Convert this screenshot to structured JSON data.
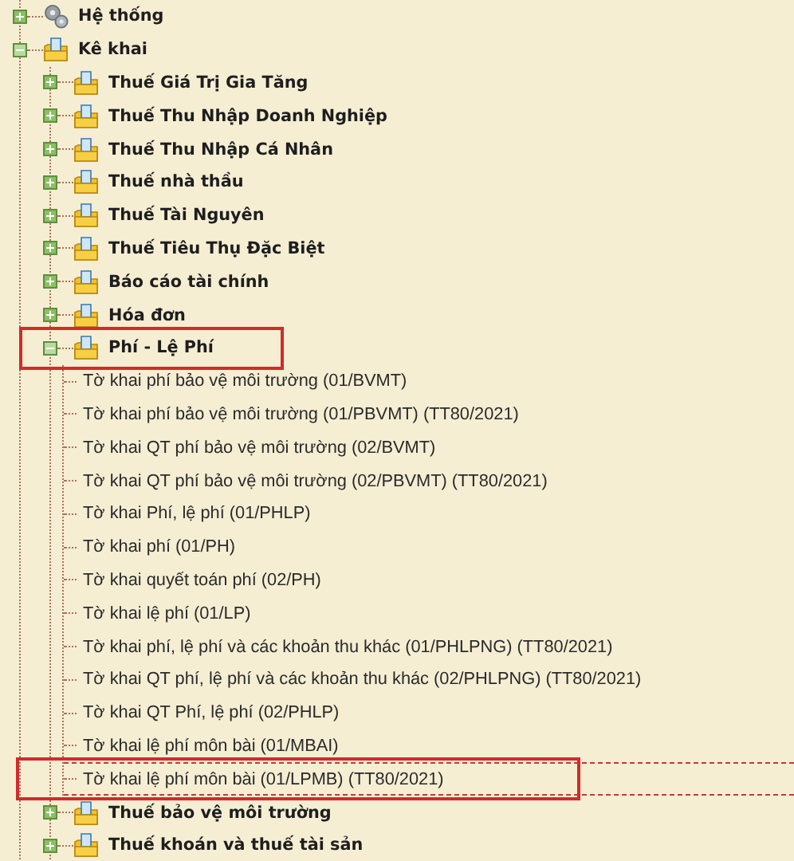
{
  "tree": [
    {
      "label": "Hệ thống",
      "kind": "system",
      "expanded": false,
      "selected": false,
      "highlighted": false
    },
    {
      "label": "Kê khai",
      "kind": "folder",
      "expanded": true,
      "selected": false,
      "highlighted": false,
      "children": [
        {
          "label": "Thuế Giá Trị Gia Tăng",
          "kind": "folder",
          "expanded": false,
          "selected": false,
          "highlighted": false
        },
        {
          "label": "Thuế Thu Nhập Doanh Nghiệp",
          "kind": "folder",
          "expanded": false,
          "selected": false,
          "highlighted": false
        },
        {
          "label": "Thuế Thu Nhập Cá Nhân",
          "kind": "folder",
          "expanded": false,
          "selected": false,
          "highlighted": false
        },
        {
          "label": "Thuế nhà thầu",
          "kind": "folder",
          "expanded": false,
          "selected": false,
          "highlighted": false
        },
        {
          "label": "Thuế Tài Nguyên",
          "kind": "folder",
          "expanded": false,
          "selected": false,
          "highlighted": false
        },
        {
          "label": "Thuế Tiêu Thụ Đặc Biệt",
          "kind": "folder",
          "expanded": false,
          "selected": false,
          "highlighted": false
        },
        {
          "label": "Báo cáo tài chính",
          "kind": "folder",
          "expanded": false,
          "selected": false,
          "highlighted": false
        },
        {
          "label": "Hóa đơn",
          "kind": "folder",
          "expanded": false,
          "selected": false,
          "highlighted": false
        },
        {
          "label": "Phí - Lệ Phí",
          "kind": "folder",
          "expanded": true,
          "selected": false,
          "highlighted": true,
          "children": [
            {
              "label": "Tờ khai phí bảo vệ môi trường (01/BVMT)",
              "kind": "form",
              "selected": false,
              "highlighted": false
            },
            {
              "label": "Tờ khai phí bảo vệ môi trường (01/PBVMT) (TT80/2021)",
              "kind": "form",
              "selected": false,
              "highlighted": false
            },
            {
              "label": "Tờ khai QT phí bảo vệ môi trường (02/BVMT)",
              "kind": "form",
              "selected": false,
              "highlighted": false
            },
            {
              "label": "Tờ khai QT phí bảo vệ môi trường (02/PBVMT) (TT80/2021)",
              "kind": "form",
              "selected": false,
              "highlighted": false
            },
            {
              "label": "Tờ khai Phí, lệ phí (01/PHLP)",
              "kind": "form",
              "selected": false,
              "highlighted": false
            },
            {
              "label": "Tờ khai phí (01/PH)",
              "kind": "form",
              "selected": false,
              "highlighted": false
            },
            {
              "label": "Tờ khai quyết toán phí (02/PH)",
              "kind": "form",
              "selected": false,
              "highlighted": false
            },
            {
              "label": "Tờ khai lệ phí (01/LP)",
              "kind": "form",
              "selected": false,
              "highlighted": false
            },
            {
              "label": "Tờ khai phí, lệ phí và các khoản thu khác (01/PHLPNG) (TT80/2021)",
              "kind": "form",
              "selected": false,
              "highlighted": false
            },
            {
              "label": "Tờ khai QT phí, lệ phí và các khoản thu khác (02/PHLPNG) (TT80/2021)",
              "kind": "form",
              "selected": false,
              "highlighted": false
            },
            {
              "label": "Tờ khai QT Phí, lệ phí (02/PHLP)",
              "kind": "form",
              "selected": false,
              "highlighted": false
            },
            {
              "label": "Tờ khai lệ phí môn bài (01/MBAI)",
              "kind": "form",
              "selected": false,
              "highlighted": false
            },
            {
              "label": "Tờ khai lệ phí môn bài (01/LPMB) (TT80/2021)",
              "kind": "form",
              "selected": true,
              "highlighted": true
            }
          ]
        },
        {
          "label": "Thuế bảo vệ môi trường",
          "kind": "folder",
          "expanded": false,
          "selected": false,
          "highlighted": false
        },
        {
          "label": "Thuế khoán và thuế tài sản",
          "kind": "folder",
          "expanded": false,
          "selected": false,
          "highlighted": false
        }
      ]
    }
  ]
}
